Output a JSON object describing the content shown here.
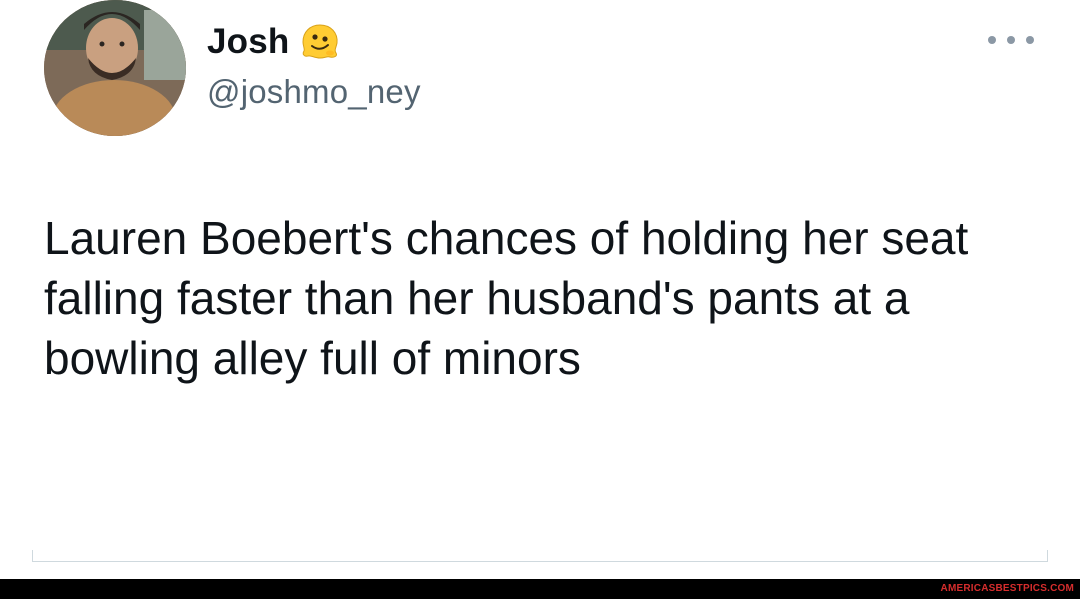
{
  "tweet": {
    "author": {
      "display_name": "Josh",
      "handle": "@joshmo_ney",
      "name_emoji": "melting-face-icon",
      "avatar": "avatar"
    },
    "more_icon": "more-horizontal-icon",
    "text": "Lauren Boebert's chances of holding her seat falling faster than her husband's pants at a bowling alley full of minors"
  },
  "watermark": {
    "text": "AMERICASBESTPICS.COM"
  },
  "colors": {
    "text_primary": "#0f1419",
    "text_secondary": "#536471",
    "watermark_red": "#d62d2d",
    "bar_black": "#000000"
  }
}
